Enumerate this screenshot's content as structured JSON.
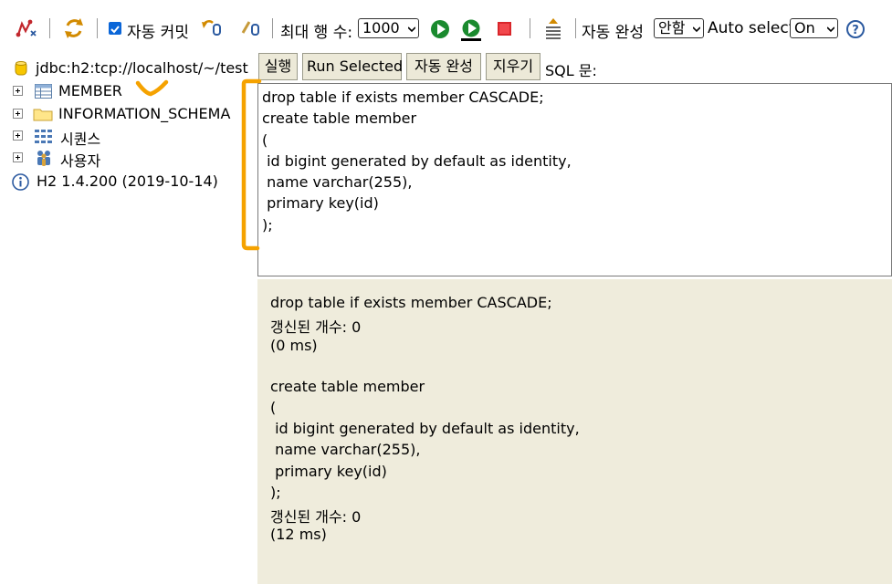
{
  "toolbar": {
    "auto_commit_label": "자동 커밋",
    "max_rows_label": "최대 행 수:",
    "max_rows_value": "1000",
    "autocomplete_label": "자동 완성",
    "autocomplete_value": "안함",
    "auto_select_label": "Auto select",
    "auto_select_value": "On",
    "auto_commit_checked": true
  },
  "tree": {
    "connection": "jdbc:h2:tcp://localhost/~/test",
    "items": [
      {
        "label": "MEMBER",
        "icon": "table-icon"
      },
      {
        "label": "INFORMATION_SCHEMA",
        "icon": "folder-icon"
      },
      {
        "label": "시퀀스",
        "icon": "sequence-icon"
      },
      {
        "label": "사용자",
        "icon": "users-icon"
      }
    ],
    "version": "H2 1.4.200 (2019-10-14)"
  },
  "buttons": {
    "run": "실행",
    "run_selected": "Run Selected",
    "autocomplete": "자동 완성",
    "clear": "지우기",
    "sql_label": "SQL 문:"
  },
  "editor": {
    "lines": [
      "drop table if exists member CASCADE;",
      "create table member",
      "(",
      " id bigint generated by default as identity,",
      " name varchar(255),",
      " primary key(id)",
      ");"
    ]
  },
  "result": {
    "lines": [
      "drop table if exists member CASCADE;",
      "갱신된 개수: 0",
      "(0 ms)",
      "",
      "create table member",
      "(",
      " id bigint generated by default as identity,",
      " name varchar(255),",
      " primary key(id)",
      ");",
      "갱신된 개수: 0",
      "(12 ms)"
    ]
  },
  "colors": {
    "annotation": "#f5a200",
    "panel_bg": "#efecdc",
    "button_bg": "#ece9d8",
    "run_green": "#1a8a2e",
    "stop_red": "#d9262b"
  }
}
